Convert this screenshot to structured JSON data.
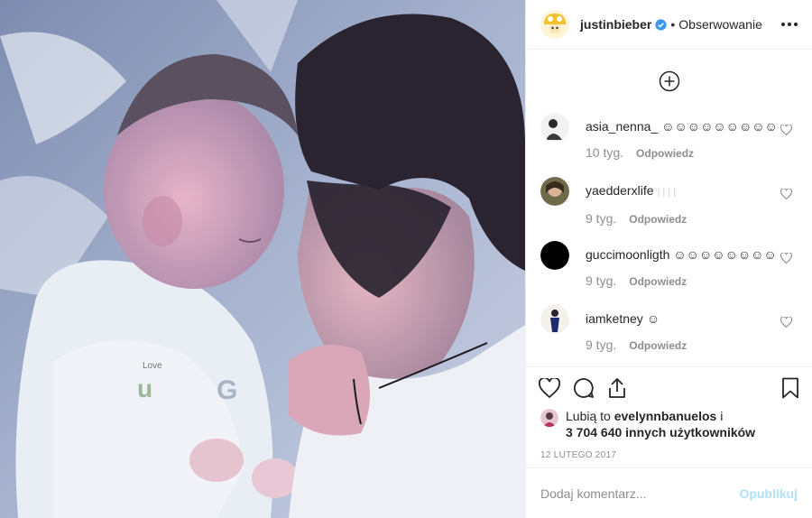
{
  "header": {
    "username": "justinbieber",
    "separator": "•",
    "follow_label": "Obserwowanie",
    "verified_icon": "verified-badge-icon",
    "verified_color": "#3897f0"
  },
  "comments": [
    {
      "user": "asia_nenna_",
      "text": "☺☺☺☺☺☺☺☺☺",
      "time": "10 tyg.",
      "reply": "Odpowiedz"
    },
    {
      "user": "yaedderxlife",
      "text": "|  |  |  |",
      "time": "9 tyg.",
      "reply": "Odpowiedz"
    },
    {
      "user": "guccimoonligth",
      "text": "☺☺☺☺☺☺☺☺",
      "time": "9 tyg.",
      "reply": "Odpowiedz"
    },
    {
      "user": "iamketney",
      "text": "☺",
      "time": "9 tyg.",
      "reply": "Odpowiedz"
    }
  ],
  "likes": {
    "prefix": "Lubią to",
    "user": "evelynnbanuelos",
    "joiner": "i",
    "count_text": "3 704 640 innych użytkowników"
  },
  "date": "12 LUTEGO 2017",
  "add_comment": {
    "placeholder": "Dodaj komentarz...",
    "post_label": "Opublikuj",
    "post_color": "#b2dffc"
  }
}
